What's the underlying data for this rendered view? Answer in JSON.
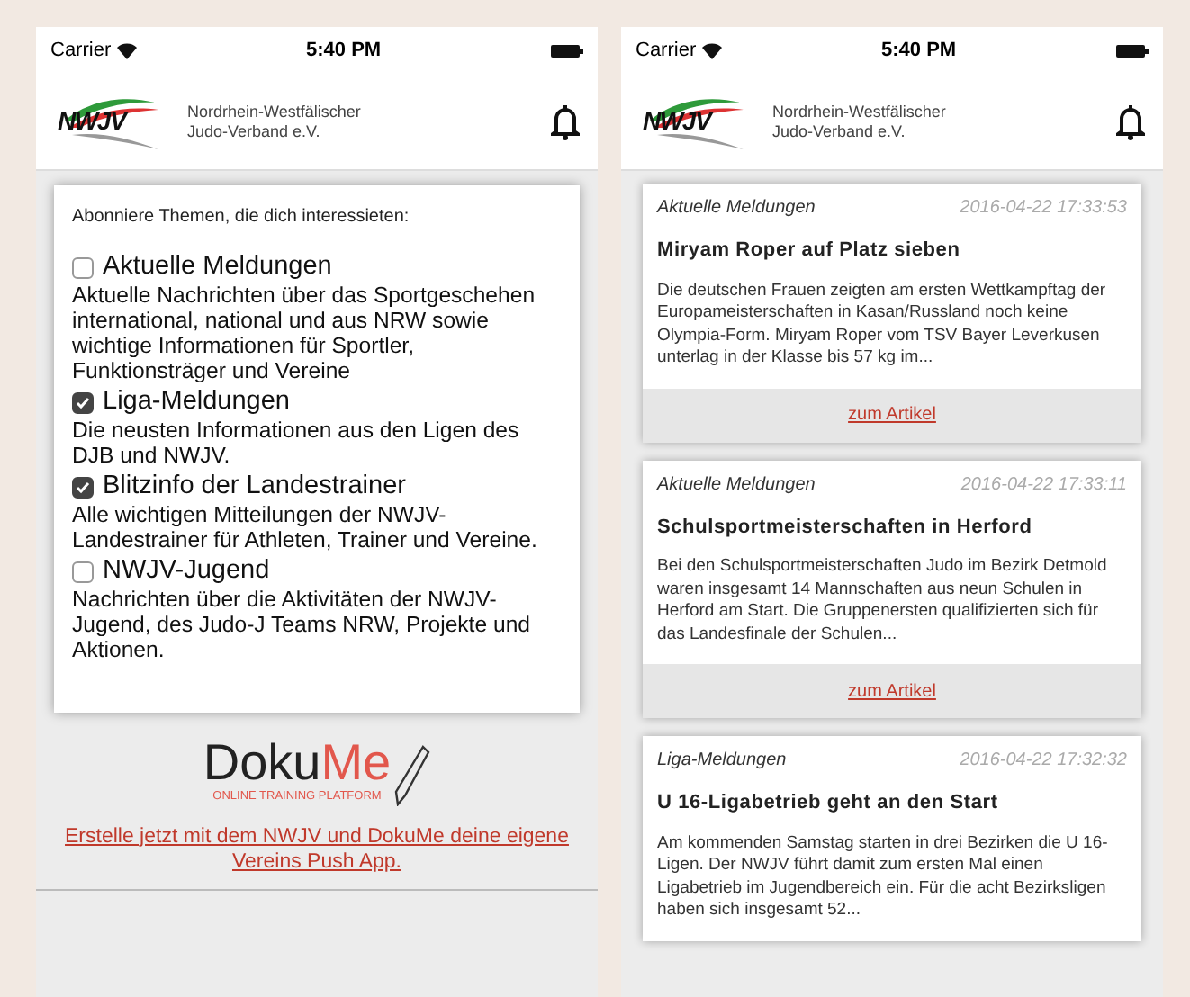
{
  "screens": [
    {
      "status_bar": {
        "carrier": "Carrier",
        "time": "5:40 PM"
      },
      "header": {
        "logo_text": "NWJV",
        "org_name_line1": "Nordrhein-Westfälischer",
        "org_name_line2": "Judo-Verband e.V."
      },
      "subscriptions": {
        "intro": "Abonniere Themen, die dich interessieten:",
        "topics": [
          {
            "title": "Aktuelle Meldungen",
            "description": "Aktuelle Nachrichten über das Sportgeschehen international, national und aus NRW sowie wichtige Informationen für Sportler, Funktionsträger und Vereine",
            "checked": false
          },
          {
            "title": "Liga-Meldungen",
            "description": "Die neusten Informationen aus den Ligen des DJB und NWJV.",
            "checked": true
          },
          {
            "title": "Blitzinfo der Landestrainer",
            "description": "Alle wichtigen Mitteilungen der NWJV-Landestrainer für Athleten, Trainer und Vereine.",
            "checked": true
          },
          {
            "title": "NWJV-Jugend",
            "description": "Nachrichten über die Aktivitäten der NWJV-Jugend, des Judo-J Teams NRW, Projekte und Aktionen.",
            "checked": false
          }
        ]
      },
      "promo": {
        "logo_part1": "Doku",
        "logo_part2": "Me",
        "logo_tagline": "ONLINE TRAINING PLATFORM",
        "link": "Erstelle jetzt mit dem NWJV und DokuMe deine eigene Vereins Push App."
      }
    },
    {
      "status_bar": {
        "carrier": "Carrier",
        "time": "5:40 PM"
      },
      "header": {
        "logo_text": "NWJV",
        "org_name_line1": "Nordrhein-Westfälischer",
        "org_name_line2": "Judo-Verband e.V."
      },
      "news": [
        {
          "category": "Aktuelle Meldungen",
          "timestamp": "2016-04-22 17:33:53",
          "title": "Miryam Roper auf Platz sieben",
          "teaser": "Die deutschen Frauen zeigten am ersten Wettkampftag der Europameisterschaften in Kasan/Russland noch keine Olympia-Form. Miryam Roper vom TSV Bayer Leverkusen unterlag in der Klasse bis 57 kg im...",
          "link": "zum Artikel"
        },
        {
          "category": "Aktuelle Meldungen",
          "timestamp": "2016-04-22 17:33:11",
          "title": "Schulsportmeisterschaften in Herford",
          "teaser": "Bei den Schulsportmeisterschaften Judo im Bezirk Detmold waren insgesamt 14 Mannschaften aus neun Schulen in Herford am Start. Die Gruppenersten qualifizierten sich für das Landesfinale der Schulen...",
          "link": "zum Artikel"
        },
        {
          "category": "Liga-Meldungen",
          "timestamp": "2016-04-22 17:32:32",
          "title": "U 16-Ligabetrieb geht an den Start",
          "teaser": "Am kommenden Samstag starten in drei Bezirken die U 16-Ligen. Der NWJV führt damit zum ersten Mal einen Ligabetrieb im Jugendbereich ein. Für die acht Bezirksligen haben sich insgesamt 52..."
        }
      ]
    }
  ]
}
